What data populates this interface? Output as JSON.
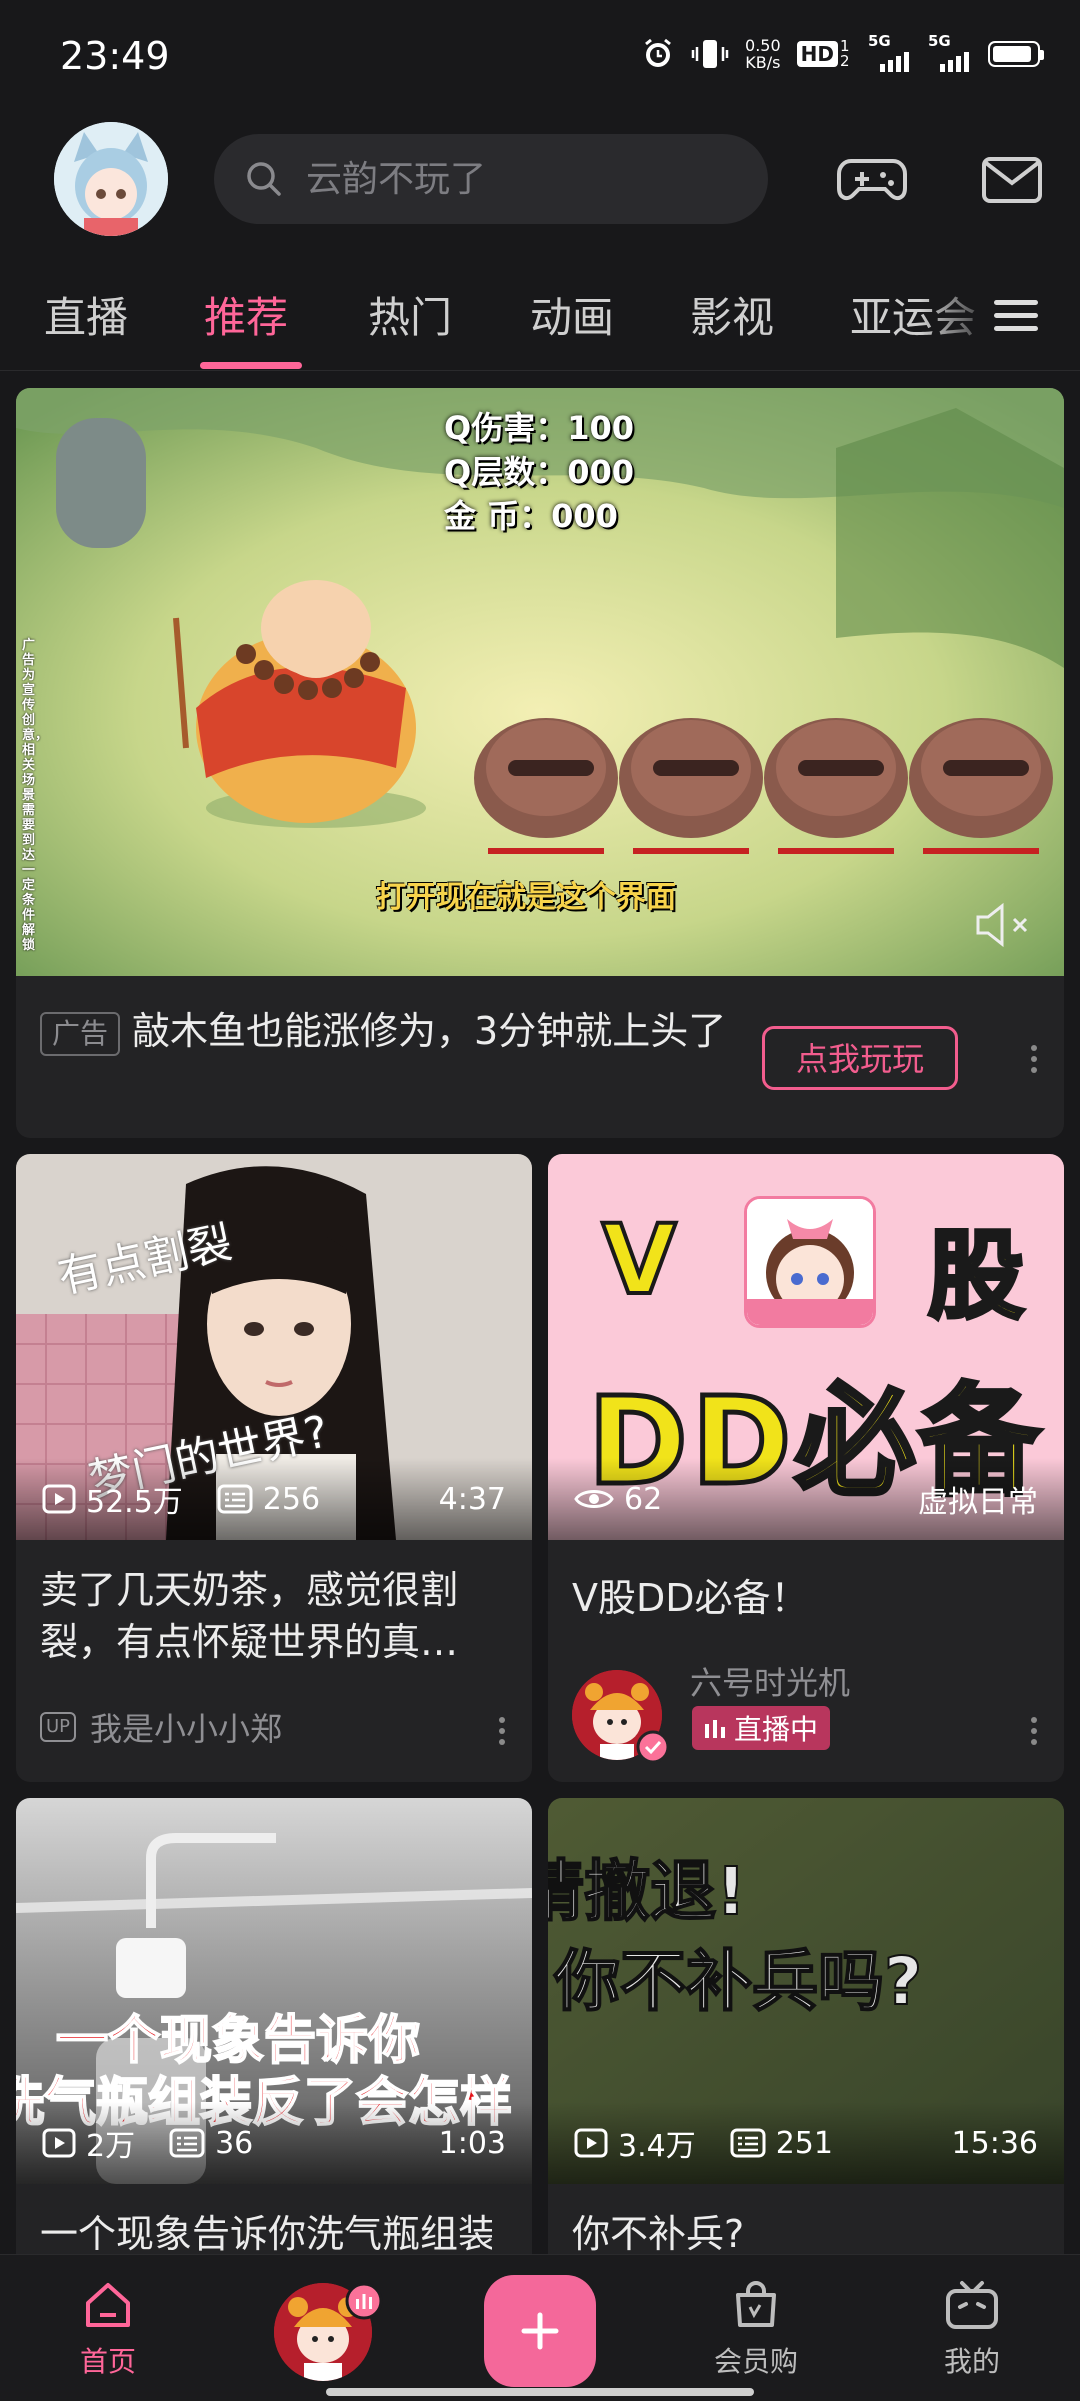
{
  "status_bar": {
    "time": "23:49",
    "net_speed_value": "0.50",
    "net_speed_unit": "KB/s",
    "hd": "HD",
    "hd_sub": "1 2",
    "signal1": "5G",
    "signal2": "5G",
    "battery_level": 0.9
  },
  "header": {
    "search_placeholder": "云韵不玩了"
  },
  "tabs": [
    "直播",
    "推荐",
    "热门",
    "动画",
    "影视",
    "亚运会"
  ],
  "active_tab": "推荐",
  "ad_card": {
    "overlay_lines": [
      "Q伤害：100",
      "Q层数：000",
      "金  币：000"
    ],
    "side_text": "广告为宣传创意，相关场景需要到达一定条件解锁",
    "caption": "打开现在就是这个界面",
    "tag": "广告",
    "title": "敲木鱼也能涨修为，3分钟就上头了",
    "button": "点我玩玩"
  },
  "feed": [
    {
      "overlay_top": "有点割裂",
      "overlay_bottom": "梦门的世界?",
      "views": "52.5万",
      "danmaku": "256",
      "duration": "4:37",
      "title": "卖了几天奶茶，感觉很割裂，有点怀疑世界的真…",
      "up_badge": "UP",
      "uploader": "我是小小小郑"
    },
    {
      "overlay_v": "V",
      "overlay_gu": "股",
      "overlay_dd": "DD必备",
      "views": "62",
      "category": "虚拟日常",
      "title": "V股DD必备！",
      "uploader": "六号时光机",
      "live": "直播中"
    },
    {
      "overlay_line1": "一个现象告诉你",
      "overlay_line2": "洗气瓶组装反了会怎样",
      "views": "2万",
      "danmaku": "36",
      "duration": "1:03",
      "title": "一个现象告诉你洗气瓶组装反了会怎样"
    },
    {
      "overlay_line1": "请撤退!",
      "overlay_line2": "你不补兵吗?",
      "views": "3.4万",
      "danmaku": "251",
      "duration": "15:36",
      "title": "你不补兵?"
    }
  ],
  "bottom_nav": {
    "home": "首页",
    "vip": "会员购",
    "mine": "我的"
  },
  "colors": {
    "accent": "#ff6699",
    "background": "#18181a",
    "card": "#232325"
  }
}
